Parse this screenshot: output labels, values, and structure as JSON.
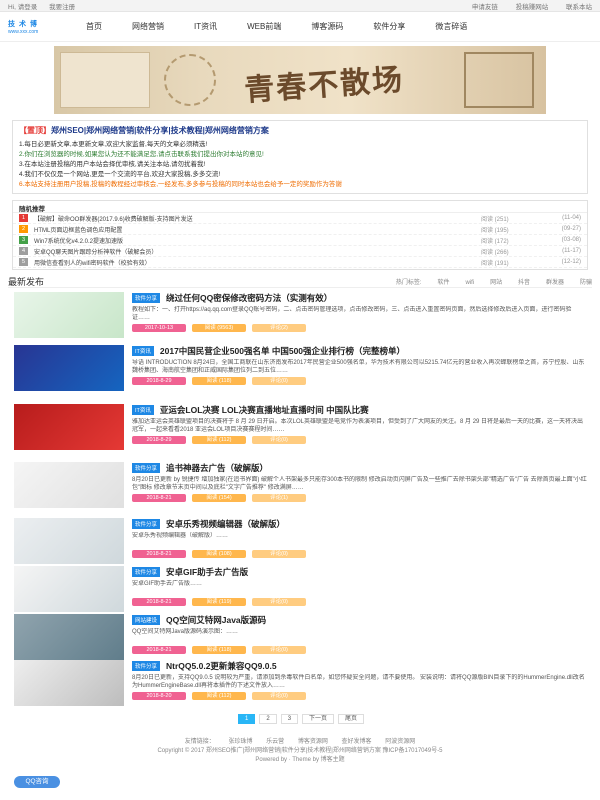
{
  "topbar": {
    "left": [
      "Hi, 请登录",
      "我要注册"
    ],
    "right": [
      "申请友链",
      "投稿赚网站",
      "联系本站"
    ]
  },
  "logo": {
    "line1": "技 术 博",
    "line2": "www.xxx.com"
  },
  "nav": [
    "首页",
    "网络营销",
    "IT资讯",
    "WEB前端",
    "博客源码",
    "软件分享",
    "微言碎语"
  ],
  "banner": {
    "title": "青春不散场"
  },
  "notice": {
    "tag": "【置顶】",
    "title": "郑州SEO|郑州网络营销|软件分享|技术教程|郑州网络营销方案",
    "lines": [
      "1.每日必更新文章,本更新文章,欢迎大家监督,每天的文章必须精选!",
      "2.你们在浏览器的时候,如果您认为还不能满足您,请点击联系我们提出你对本站的意见!",
      "3.在本站注册投稿的用户本站会择优审核,请关注本站,请勿扰着我!",
      "4.我们不仅仅是一个网站,更是一个交流的平台,欢迎大家投稿,多多交流!",
      "6.本站支持注册用户投稿,投稿的教程经过审核会,一经发布,多多参与投稿的同时本站也会给予一定的奖励作为答谢"
    ]
  },
  "rec": {
    "head": "随机推荐",
    "items": [
      {
        "num": "1",
        "color": "#e53935",
        "title": "【破解】破命OO群发器(2017.9.6)收费破解版-支持图片发送",
        "views": "阅读 (251)",
        "date": "(11-04)"
      },
      {
        "num": "2",
        "color": "#ff9800",
        "title": "HTML页面边框蓝色调色应用配置",
        "views": "阅读 (195)",
        "date": "(09-27)"
      },
      {
        "num": "3",
        "color": "#43a047",
        "title": "Win7系统优化v4.2.0.2提速加速版",
        "views": "阅读 (172)",
        "date": "(03-08)"
      },
      {
        "num": "4",
        "color": "#9e9e9e",
        "title": "安卓QQ聊天图片跟踪分析神软件（破解会员）",
        "views": "阅读 (266)",
        "date": "(11-17)"
      },
      {
        "num": "5",
        "color": "#9e9e9e",
        "title": "用微信查看别人的wifi密码软件（校验有效）",
        "views": "阅读 (191)",
        "date": "(12-12)"
      }
    ]
  },
  "latest": {
    "title": "最新发布",
    "keywords": [
      "热门标签:",
      "软件",
      "wifi",
      "网站",
      "抖音",
      "群发器",
      "防骗"
    ]
  },
  "posts": [
    {
      "cat": "软件分享",
      "title": "绕过任何QQ密保修改密码方法（实测有效）",
      "desc": "教程如下：一、打开https://aq.qq.com登录QQ账号密码，二、点击密码管理选项，点击修改密码，三、点击进入重置密码页面，然后选择修改后进入页面，进行密码验证……",
      "date": "2017-10-13",
      "views": "阅读 (9563)",
      "comm": "评论(2)"
    },
    {
      "cat": "IT资讯",
      "title": "2017中国民营企业500强名单 中国500强企业排行榜（完整榜单）",
      "desc": "导语 INTRODUCTION 8月24日，全国工商联在山东济南发布2017年民营企业500强名单，华为技术有限公司以5215.74亿元的营业收入再次蝉联榜单之首，苏宁控股、山东魏桥集团、海南航空集团和正威国际集团位列二到五位……",
      "date": "2018-8-29",
      "views": "阅读 (118)",
      "comm": "评论(0)"
    },
    {
      "cat": "IT资讯",
      "title": "亚运会LOL决赛 LOL决赛直播地址直播时间 中国队比赛",
      "desc": "雅加达亚运会英雄联盟项目的决赛将于 8 月 29 日开启。本次LOL英雄联盟是电竞作为表演项目，但受到了广大网友的关注。8 月 29 日将是最后一天的比赛，这一天将决出冠军，一起来看看2018 亚运会LOL项目决赛赛程时间……",
      "date": "2018-8-29",
      "views": "阅读 (112)",
      "comm": "评论(0)"
    },
    {
      "cat": "软件分享",
      "title": "追书神器去广告（破解版）",
      "desc": "8月20日已更新 by 锐捷传 增加独家(在追书界面) 破解个人书架最多只能存300本书的限制 修改启动页闪屏广告及一些推广去除书架头部\"精选广告\"广告 去除首页最上面\"小红包\"图标 修改章节末页中间以及底栏\"文字广告推荐\" 修改满屏……",
      "date": "2018-8-21",
      "views": "阅读 (154)",
      "comm": "评论(1)"
    },
    {
      "cat": "软件分享",
      "title": "安卓乐秀视频编辑器（破解版）",
      "desc": "安卓乐秀视频编辑器（破解版）……",
      "date": "2018-8-21",
      "views": "阅读 (108)",
      "comm": "评论(0)"
    },
    {
      "cat": "软件分享",
      "title": "安卓GIF助手去广告版",
      "desc": "安卓GIF助手去广告版……",
      "date": "2018-8-21",
      "views": "阅读 (119)",
      "comm": "评论(0)"
    },
    {
      "cat": "网站建设",
      "title": "QQ空间艾特网Java版源码",
      "desc": "QQ空间艾特网Java版源码演示图：……",
      "date": "2018-8-21",
      "views": "阅读 (118)",
      "comm": "评论(0)"
    },
    {
      "cat": "软件分享",
      "title": "NtrQQ5.0.2更新兼容QQ9.0.5",
      "desc": "8月20日已更新，支持QQ9.0.5 说明较为严重，请添加到杀毒软件白名单，如您怀疑安全问题，请不要使用。 安装说明：请将QQ源版BIN目录下的的HummerEngine.dll改名为HummerEngineBase.dll再将本插件的下述文件放入……",
      "date": "2018-8-20",
      "views": "阅读 (112)",
      "comm": "评论(0)"
    }
  ],
  "pager": [
    "1",
    "2",
    "3",
    "下一页",
    "尾页"
  ],
  "footer": {
    "links": [
      "友情链接：",
      "张珍珠博",
      "乐云营",
      "博客资源网",
      "查好发博客",
      "阿波资源网"
    ],
    "copyright": "Copyright © 2017 郑州SEO推广|郑州网络营销|软件分享|技术教程|郑州网络营销方案 豫ICP备17017049号-5",
    "powered": "Powered by · Theme by 博客主题"
  },
  "floatbtn": "QQ咨询"
}
